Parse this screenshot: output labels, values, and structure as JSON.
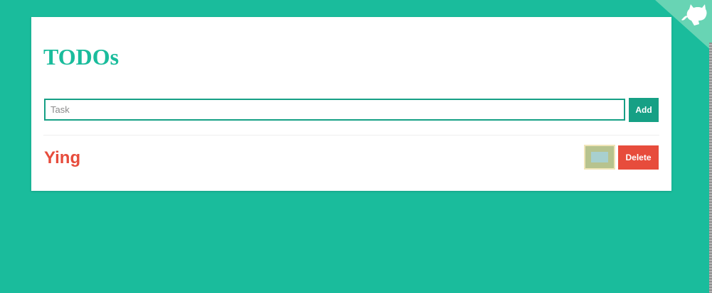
{
  "app": {
    "title": "TODOs"
  },
  "form": {
    "task_placeholder": "Task",
    "task_value": "",
    "add_label": "Add"
  },
  "todos": [
    {
      "label": "Ying",
      "delete_label": "Delete",
      "swatch_color": "#b7c38e"
    }
  ],
  "colors": {
    "background": "#1abc9c",
    "accent": "#16a085",
    "danger": "#e74c3c",
    "card": "#ffffff"
  },
  "icons": {
    "corner": "github-octocat-icon"
  }
}
